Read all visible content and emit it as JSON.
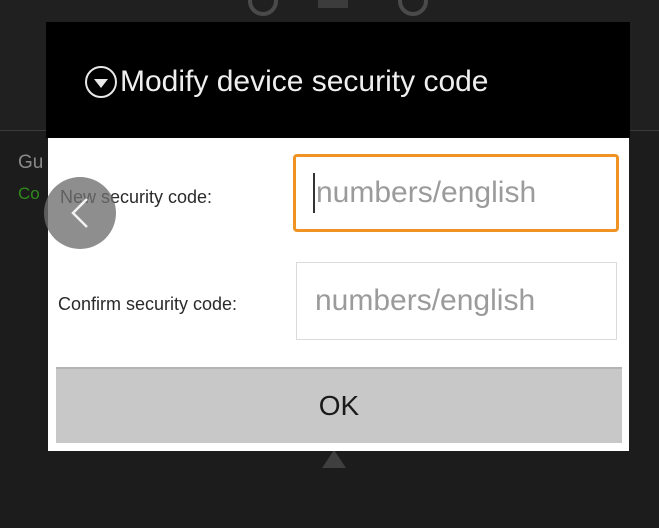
{
  "background": {
    "partial_text_1": "Gu",
    "partial_text_2": "Co"
  },
  "dialog": {
    "title": "Modify device security code",
    "title_icon": "chevron-down-circle-icon",
    "fields": {
      "new_code": {
        "label": "New security code:",
        "value": "",
        "placeholder": "numbers/english",
        "focused": true
      },
      "confirm_code": {
        "label": "Confirm security code:",
        "value": "",
        "placeholder": "numbers/english"
      }
    },
    "ok_label": "OK"
  },
  "back_button": {
    "icon": "chevron-left-icon"
  },
  "colors": {
    "focus_border": "#ef9424",
    "dialog_header": "#000000",
    "button": "#c8c8c8",
    "bg_status_text": "#2f8a1c"
  }
}
